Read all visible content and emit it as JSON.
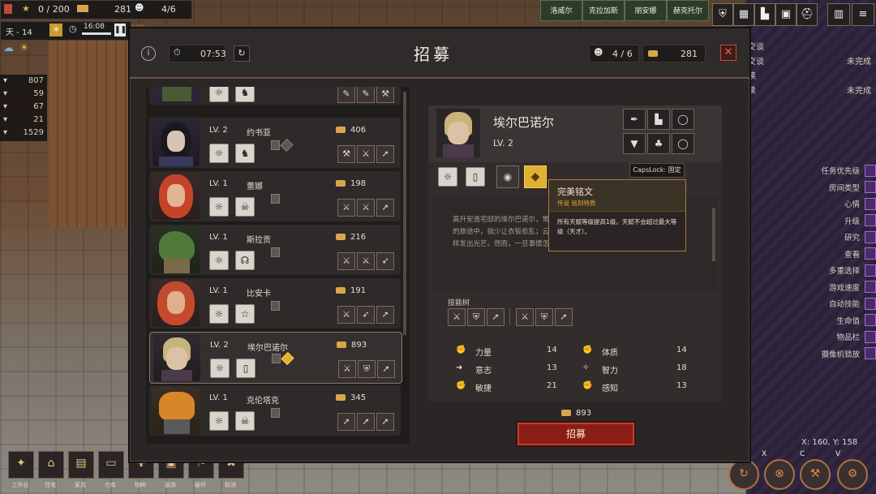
{
  "hud": {
    "population": "0 / 200",
    "coins": "281",
    "colonists": "4/6",
    "day": "天 - 14",
    "clock": "16:08"
  },
  "side_resources": [
    {
      "icon": "log-icon",
      "value": "807"
    },
    {
      "icon": "stone-icon",
      "value": "59"
    },
    {
      "icon": "ore-icon",
      "value": "67"
    },
    {
      "icon": "herb-icon",
      "value": "21"
    },
    {
      "icon": "food-icon",
      "value": "1529"
    }
  ],
  "colonist_tabs": [
    "洛威尔",
    "克拉加斯",
    "丽安娜",
    "赫克托尔"
  ],
  "tasks": [
    {
      "name": "交谈",
      "status": ""
    },
    {
      "name": "交谈",
      "status": "未完成"
    },
    {
      "name": "读",
      "status": ""
    },
    {
      "name": "读",
      "status": "未完成"
    }
  ],
  "priorities": [
    "任务优先级",
    "房间类型",
    "心情",
    "升级",
    "研究",
    "查看",
    "多重选择",
    "游戏速度",
    "自动技能",
    "生命值",
    "物品栏",
    "摄像机锁放"
  ],
  "coords": "X: 160, Y: 158",
  "hotkeys": [
    "X",
    "C",
    "V"
  ],
  "build_bar": [
    "工作台",
    "住宅",
    "家具",
    "仓库",
    "物种",
    "装饰",
    "破坏",
    "取消"
  ],
  "dialog": {
    "title": "招募",
    "timer": "07:53",
    "colonists": "4 / 6",
    "coins": "281"
  },
  "candidates": [
    {
      "lv": "",
      "name": "",
      "cost": "",
      "portrait": "goblin-hood"
    },
    {
      "lv": "LV. 2",
      "name": "约书亚",
      "cost": "406",
      "portrait": "dark-hair"
    },
    {
      "lv": "LV. 1",
      "name": "蕾娜",
      "cost": "198",
      "portrait": "red-hair"
    },
    {
      "lv": "LV. 1",
      "name": "斯拉贡",
      "cost": "216",
      "portrait": "lizard"
    },
    {
      "lv": "LV. 1",
      "name": "比安卡",
      "cost": "191",
      "portrait": "red-curly"
    },
    {
      "lv": "LV. 2",
      "name": "埃尔巴诺尔",
      "cost": "893",
      "portrait": "elf"
    },
    {
      "lv": "LV. 1",
      "name": "克伦塔克",
      "cost": "345",
      "portrait": "orange-lizard"
    }
  ],
  "selected": {
    "name": "埃尔巴诺尔",
    "lv": "LV. 2",
    "desc_lines": [
      "高升安逸宅邸的埃尔巴诺尔，常",
      "的旅途中，拙少让衣钣愈乱；云",
      "样发出光芒。然而，一旦事情怎"
    ],
    "skill_tree_label": "技能树",
    "stats": [
      {
        "label": "力量",
        "value": "14"
      },
      {
        "label": "体质",
        "value": "14"
      },
      {
        "label": "意志",
        "value": "13"
      },
      {
        "label": "智力",
        "value": "18"
      },
      {
        "label": "敏捷",
        "value": "21"
      },
      {
        "label": "感知",
        "value": "13"
      }
    ],
    "cost": "893",
    "recruit_label": "招募"
  },
  "capslock": "CapsLock: 固定",
  "tooltip": {
    "title": "完美铭文",
    "subtitle": "传说 铭刻特质",
    "body": "所有天赋等级提高1级。天赋不会超过最大等级（天才）。"
  }
}
